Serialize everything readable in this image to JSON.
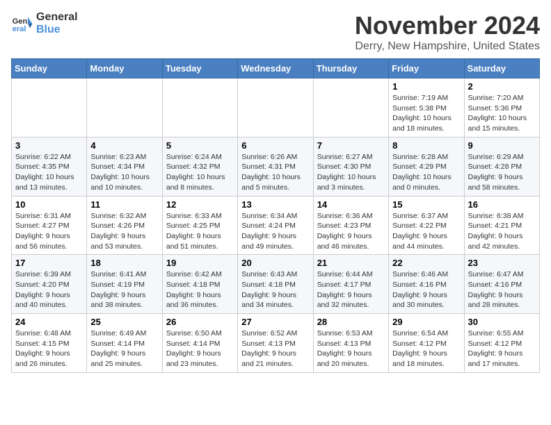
{
  "logo": {
    "line1": "General",
    "line2": "Blue"
  },
  "title": "November 2024",
  "location": "Derry, New Hampshire, United States",
  "days_of_week": [
    "Sunday",
    "Monday",
    "Tuesday",
    "Wednesday",
    "Thursday",
    "Friday",
    "Saturday"
  ],
  "weeks": [
    [
      {
        "day": "",
        "info": ""
      },
      {
        "day": "",
        "info": ""
      },
      {
        "day": "",
        "info": ""
      },
      {
        "day": "",
        "info": ""
      },
      {
        "day": "",
        "info": ""
      },
      {
        "day": "1",
        "info": "Sunrise: 7:19 AM\nSunset: 5:38 PM\nDaylight: 10 hours and 18 minutes."
      },
      {
        "day": "2",
        "info": "Sunrise: 7:20 AM\nSunset: 5:36 PM\nDaylight: 10 hours and 15 minutes."
      }
    ],
    [
      {
        "day": "3",
        "info": "Sunrise: 6:22 AM\nSunset: 4:35 PM\nDaylight: 10 hours and 13 minutes."
      },
      {
        "day": "4",
        "info": "Sunrise: 6:23 AM\nSunset: 4:34 PM\nDaylight: 10 hours and 10 minutes."
      },
      {
        "day": "5",
        "info": "Sunrise: 6:24 AM\nSunset: 4:32 PM\nDaylight: 10 hours and 8 minutes."
      },
      {
        "day": "6",
        "info": "Sunrise: 6:26 AM\nSunset: 4:31 PM\nDaylight: 10 hours and 5 minutes."
      },
      {
        "day": "7",
        "info": "Sunrise: 6:27 AM\nSunset: 4:30 PM\nDaylight: 10 hours and 3 minutes."
      },
      {
        "day": "8",
        "info": "Sunrise: 6:28 AM\nSunset: 4:29 PM\nDaylight: 10 hours and 0 minutes."
      },
      {
        "day": "9",
        "info": "Sunrise: 6:29 AM\nSunset: 4:28 PM\nDaylight: 9 hours and 58 minutes."
      }
    ],
    [
      {
        "day": "10",
        "info": "Sunrise: 6:31 AM\nSunset: 4:27 PM\nDaylight: 9 hours and 56 minutes."
      },
      {
        "day": "11",
        "info": "Sunrise: 6:32 AM\nSunset: 4:26 PM\nDaylight: 9 hours and 53 minutes."
      },
      {
        "day": "12",
        "info": "Sunrise: 6:33 AM\nSunset: 4:25 PM\nDaylight: 9 hours and 51 minutes."
      },
      {
        "day": "13",
        "info": "Sunrise: 6:34 AM\nSunset: 4:24 PM\nDaylight: 9 hours and 49 minutes."
      },
      {
        "day": "14",
        "info": "Sunrise: 6:36 AM\nSunset: 4:23 PM\nDaylight: 9 hours and 46 minutes."
      },
      {
        "day": "15",
        "info": "Sunrise: 6:37 AM\nSunset: 4:22 PM\nDaylight: 9 hours and 44 minutes."
      },
      {
        "day": "16",
        "info": "Sunrise: 6:38 AM\nSunset: 4:21 PM\nDaylight: 9 hours and 42 minutes."
      }
    ],
    [
      {
        "day": "17",
        "info": "Sunrise: 6:39 AM\nSunset: 4:20 PM\nDaylight: 9 hours and 40 minutes."
      },
      {
        "day": "18",
        "info": "Sunrise: 6:41 AM\nSunset: 4:19 PM\nDaylight: 9 hours and 38 minutes."
      },
      {
        "day": "19",
        "info": "Sunrise: 6:42 AM\nSunset: 4:18 PM\nDaylight: 9 hours and 36 minutes."
      },
      {
        "day": "20",
        "info": "Sunrise: 6:43 AM\nSunset: 4:18 PM\nDaylight: 9 hours and 34 minutes."
      },
      {
        "day": "21",
        "info": "Sunrise: 6:44 AM\nSunset: 4:17 PM\nDaylight: 9 hours and 32 minutes."
      },
      {
        "day": "22",
        "info": "Sunrise: 6:46 AM\nSunset: 4:16 PM\nDaylight: 9 hours and 30 minutes."
      },
      {
        "day": "23",
        "info": "Sunrise: 6:47 AM\nSunset: 4:16 PM\nDaylight: 9 hours and 28 minutes."
      }
    ],
    [
      {
        "day": "24",
        "info": "Sunrise: 6:48 AM\nSunset: 4:15 PM\nDaylight: 9 hours and 26 minutes."
      },
      {
        "day": "25",
        "info": "Sunrise: 6:49 AM\nSunset: 4:14 PM\nDaylight: 9 hours and 25 minutes."
      },
      {
        "day": "26",
        "info": "Sunrise: 6:50 AM\nSunset: 4:14 PM\nDaylight: 9 hours and 23 minutes."
      },
      {
        "day": "27",
        "info": "Sunrise: 6:52 AM\nSunset: 4:13 PM\nDaylight: 9 hours and 21 minutes."
      },
      {
        "day": "28",
        "info": "Sunrise: 6:53 AM\nSunset: 4:13 PM\nDaylight: 9 hours and 20 minutes."
      },
      {
        "day": "29",
        "info": "Sunrise: 6:54 AM\nSunset: 4:12 PM\nDaylight: 9 hours and 18 minutes."
      },
      {
        "day": "30",
        "info": "Sunrise: 6:55 AM\nSunset: 4:12 PM\nDaylight: 9 hours and 17 minutes."
      }
    ]
  ]
}
